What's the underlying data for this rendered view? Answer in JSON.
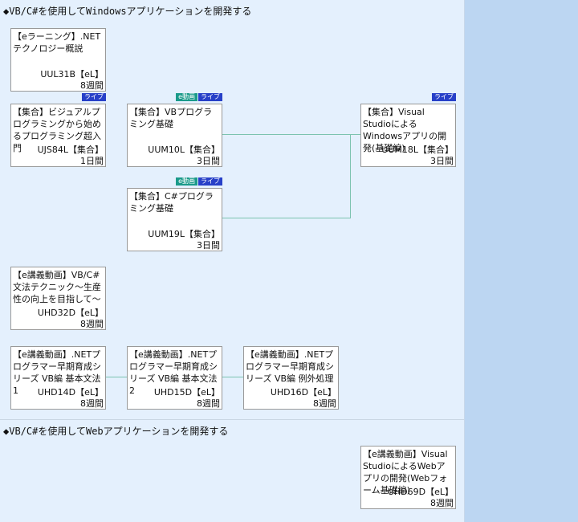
{
  "sections": [
    {
      "title": "◆VB/C#を使用してWindowsアプリケーションを開発する"
    },
    {
      "title": "◆VB/C#を使用してWebアプリケーションを開発する"
    }
  ],
  "courses": [
    {
      "title": "【eラーニング】.NETテクノロジー概説",
      "code": "UUL31B【eL】",
      "duration": "8週間",
      "badges": []
    },
    {
      "title": "【集合】ビジュアルプログラミングから始めるプログラミング超入門",
      "code": "UJS84L【集合】",
      "duration": "1日間",
      "badges": [
        "ライブ"
      ]
    },
    {
      "title": "【集合】VBプログラミング基礎",
      "code": "UUM10L【集合】",
      "duration": "3日間",
      "badges": [
        "e動画",
        "ライブ"
      ]
    },
    {
      "title": "【集合】Visual StudioによるWindowsアプリの開発(基礎編)",
      "code": "UUM18L【集合】",
      "duration": "3日間",
      "badges": [
        "ライブ"
      ]
    },
    {
      "title": "【集合】C#プログラミング基礎",
      "code": "UUM19L【集合】",
      "duration": "3日間",
      "badges": [
        "e動画",
        "ライブ"
      ]
    },
    {
      "title": "【e講義動画】VB/C#文法テクニック～生産性の向上を目指して～",
      "code": "UHD32D【eL】",
      "duration": "8週間",
      "badges": []
    },
    {
      "title": "【e講義動画】.NETプログラマー早期育成シリーズ VB編 基本文法1",
      "code": "UHD14D【eL】",
      "duration": "8週間",
      "badges": []
    },
    {
      "title": "【e講義動画】.NETプログラマー早期育成シリーズ VB編 基本文法2",
      "code": "UHD15D【eL】",
      "duration": "8週間",
      "badges": []
    },
    {
      "title": "【e講義動画】.NETプログラマー早期育成シリーズ VB編 例外処理",
      "code": "UHD16D【eL】",
      "duration": "8週間",
      "badges": []
    },
    {
      "title": "【e講義動画】Visual StudioによるWebアプリの開発(Webフォーム基礎編)",
      "code": "UHD69D【eL】",
      "duration": "8週間",
      "badges": []
    }
  ],
  "colors": {
    "connector": "#7cc3b0",
    "live_badge": "#2740c8",
    "video_badge": "#1a9a8a",
    "background": "#e4f0fd",
    "side_panel": "#bcd6f2"
  }
}
